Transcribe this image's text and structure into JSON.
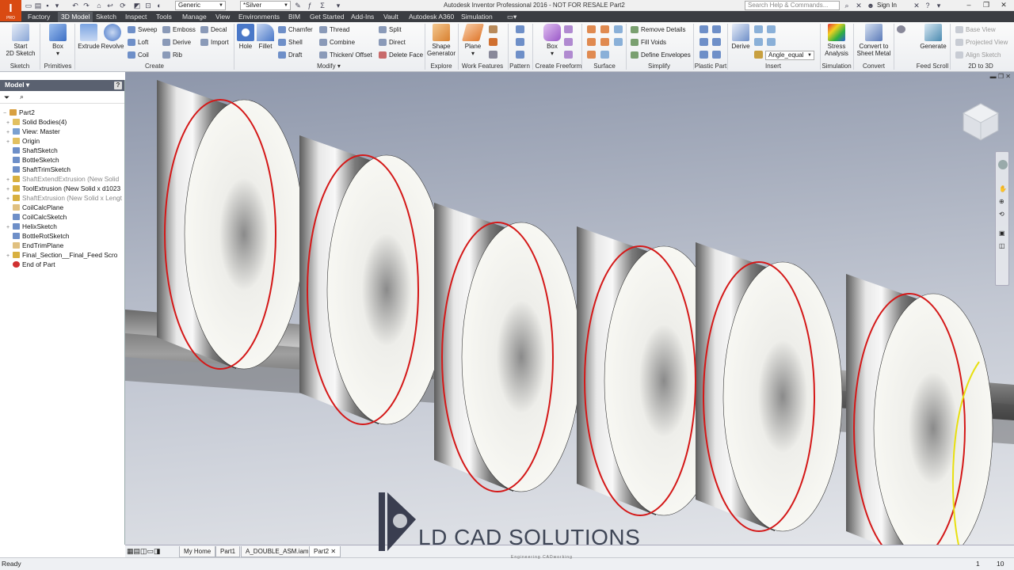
{
  "app": {
    "logo_letter": "I",
    "logo_sub": "PRO",
    "title": "Autodesk Inventor Professional 2016 - NOT FOR RESALE   Part2"
  },
  "qat": {
    "material": "Generic",
    "appearance": "*Silver"
  },
  "search": {
    "placeholder": "Search Help & Commands..."
  },
  "user": {
    "signin": "Sign In"
  },
  "tabs": [
    "Factory",
    "3D Model",
    "Sketch",
    "Inspect",
    "Tools",
    "Manage",
    "View",
    "Environments",
    "BIM",
    "Get Started",
    "Add-Ins",
    "Vault",
    "Autodesk A360",
    "Simulation"
  ],
  "active_tab": "3D Model",
  "ribbon": {
    "start_sketch": "Start\n2D Sketch",
    "box": "Box",
    "extrude": "Extrude",
    "revolve": "Revolve",
    "sweep": "Sweep",
    "loft": "Loft",
    "coil": "Coil",
    "emboss": "Emboss",
    "derive": "Derive",
    "rib": "Rib",
    "decal": "Decal",
    "import": "Import",
    "hole": "Hole",
    "fillet": "Fillet",
    "chamfer": "Chamfer",
    "shell": "Shell",
    "draft": "Draft",
    "thread": "Thread",
    "combine": "Combine",
    "thicken": "Thicken/ Offset",
    "split": "Split",
    "direct": "Direct",
    "delete_face": "Delete Face",
    "shape_generator": "Shape\nGenerator",
    "plane": "Plane",
    "ff_box": "Box",
    "remove_details": "Remove Details",
    "fill_voids": "Fill Voids",
    "define_envelopes": "Define Envelopes",
    "derive2": "Derive",
    "angle_equal": "Angle_equal",
    "stress_analysis": "Stress\nAnalysis",
    "convert_sheet_metal": "Convert to\nSheet Metal",
    "generate": "Generate",
    "base_view": "Base View",
    "projected_view": "Projected View",
    "align_sketch": "Align Sketch"
  },
  "panels": [
    "Sketch",
    "Primitives",
    "Create",
    "Modify",
    "Explore",
    "Work Features",
    "Pattern",
    "Create Freeform",
    "Surface",
    "Simplify",
    "Plastic Part",
    "Insert",
    "Simulation",
    "Convert",
    "Feed Scroll",
    "2D to 3D"
  ],
  "browser": {
    "title": "Model",
    "items": [
      {
        "label": "Part2",
        "expander": "−",
        "dim": false,
        "icon": "part-icon"
      },
      {
        "label": "Solid Bodies(4)",
        "expander": "+",
        "dim": false,
        "icon": "folder-icon"
      },
      {
        "label": "View: Master",
        "expander": "+",
        "dim": false,
        "icon": "view-icon"
      },
      {
        "label": "Origin",
        "expander": "+",
        "dim": false,
        "icon": "folder-icon"
      },
      {
        "label": "ShaftSketch",
        "expander": "",
        "dim": false,
        "icon": "sketch-icon"
      },
      {
        "label": "BottleSketch",
        "expander": "",
        "dim": false,
        "icon": "sketch-icon"
      },
      {
        "label": "ShaftTrimSketch",
        "expander": "",
        "dim": false,
        "icon": "sketch-icon"
      },
      {
        "label": "ShaftExtendExtrusion (New Solid",
        "expander": "+",
        "dim": true,
        "icon": "extrude-icon"
      },
      {
        "label": "ToolExtrusion (New Solid x d1023",
        "expander": "+",
        "dim": false,
        "icon": "extrude-icon"
      },
      {
        "label": "ShaftExtrusion (New Solid x Lengt",
        "expander": "+",
        "dim": true,
        "icon": "extrude-icon"
      },
      {
        "label": "CoilCalcPlane",
        "expander": "",
        "dim": false,
        "icon": "plane-icon"
      },
      {
        "label": "CoilCalcSketch",
        "expander": "",
        "dim": false,
        "icon": "sketch-icon"
      },
      {
        "label": "HelixSketch",
        "expander": "+",
        "dim": false,
        "icon": "sketch-icon"
      },
      {
        "label": "BottleRotSketch",
        "expander": "",
        "dim": false,
        "icon": "sketch-icon"
      },
      {
        "label": "EndTrimPlane",
        "expander": "",
        "dim": false,
        "icon": "plane-icon"
      },
      {
        "label": "Final_Section__Final_Feed Scro",
        "expander": "+",
        "dim": false,
        "icon": "sweep-icon"
      },
      {
        "label": "End of Part",
        "expander": "",
        "dim": false,
        "icon": "end-of-part-icon"
      }
    ]
  },
  "documents": [
    "My Home",
    "Part1",
    "A_DOUBLE_ASM.iam",
    "Part2"
  ],
  "active_document": "Part2",
  "status": {
    "left": "Ready",
    "count1": "1",
    "count2": "10"
  },
  "watermark": {
    "text": "LD CAD SOLUTIONS",
    "sub": "Engineering   CADworking"
  },
  "colors": {
    "accent": "#d94a12",
    "tab_bar": "#3b3d42",
    "sketch_curve": "#d41818",
    "highlight_curve": "#e8e010"
  }
}
